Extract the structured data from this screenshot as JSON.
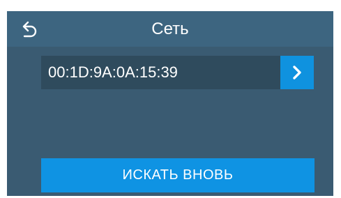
{
  "header": {
    "title": "Сеть",
    "back_icon": "back-arrow-icon"
  },
  "devices": [
    {
      "label": "00:1D:9A:0A:15:39",
      "action_icon": "chevron-right-icon"
    }
  ],
  "actions": {
    "search_again_label": "ИСКАТЬ ВНОВЬ"
  },
  "colors": {
    "background": "#3a5b72",
    "header": "#3d6580",
    "row": "#2f4b5d",
    "accent": "#0f92df",
    "text": "#ffffff"
  }
}
